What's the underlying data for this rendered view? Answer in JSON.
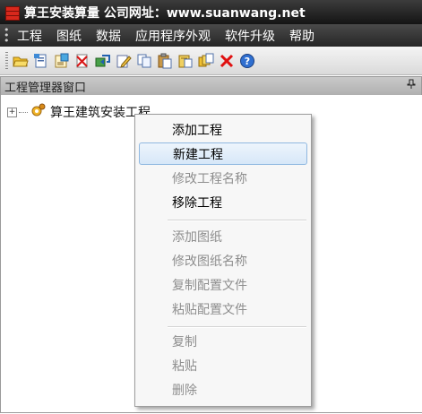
{
  "window": {
    "title": "算王安装算量 公司网址：www.suanwang.net"
  },
  "menu": [
    "工程",
    "图纸",
    "数据",
    "应用程序外观",
    "软件升级",
    "帮助"
  ],
  "toolbar": {
    "buttons": [
      "open-folder-icon",
      "new-file-icon",
      "properties-icon",
      "delete-doc-icon",
      "export-icon",
      "edit-icon",
      "copy-icon",
      "paste-icon",
      "paste-special-icon",
      "multi-copy-icon",
      "close-x-icon",
      "help-icon"
    ]
  },
  "panel": {
    "title": "工程管理器窗口",
    "pin": "ᵖ"
  },
  "tree": {
    "expander": "+",
    "root_label": "算王建筑安装工程"
  },
  "context_menu": {
    "items": [
      {
        "label": "添加工程",
        "enabled": true
      },
      {
        "label": "新建工程",
        "enabled": true,
        "highlighted": true
      },
      {
        "label": "修改工程名称",
        "enabled": false
      },
      {
        "label": "移除工程",
        "enabled": true
      },
      {
        "label": "添加图纸",
        "enabled": false
      },
      {
        "label": "修改图纸名称",
        "enabled": false
      },
      {
        "label": "复制配置文件",
        "enabled": false
      },
      {
        "label": "粘贴配置文件",
        "enabled": false
      },
      {
        "label": "复制",
        "enabled": false
      },
      {
        "label": "粘贴",
        "enabled": false
      },
      {
        "label": "删除",
        "enabled": false
      }
    ]
  },
  "colors": {
    "titlebar": "#1e1e1e",
    "highlight_border": "#90b8e0",
    "disabled_text": "#8e8e8e"
  }
}
